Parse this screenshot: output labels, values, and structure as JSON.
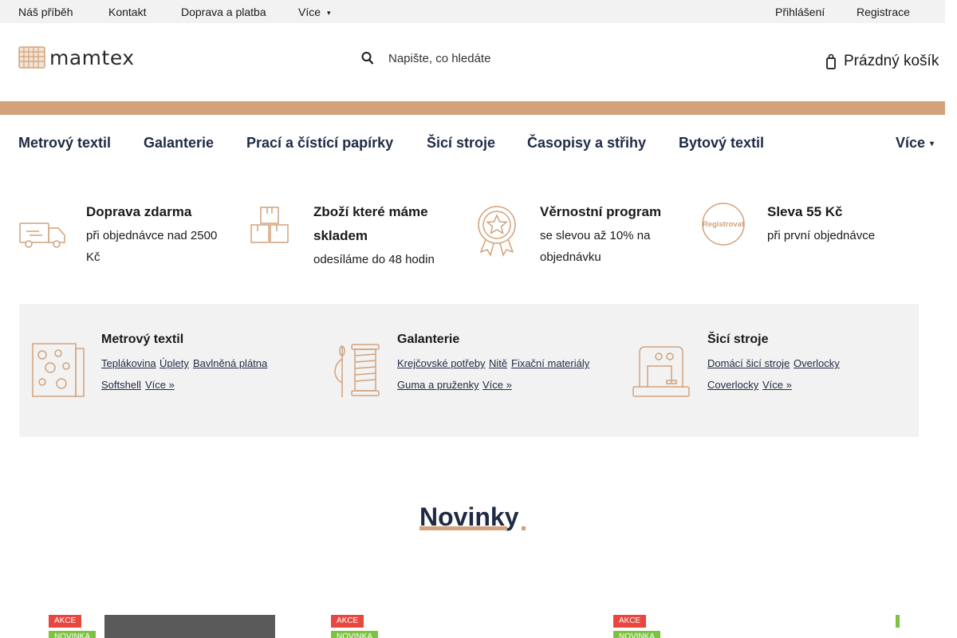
{
  "topbar": {
    "links": [
      "Náš příběh",
      "Kontakt",
      "Doprava a platba",
      "Více"
    ],
    "login": "Přihlášení",
    "register": "Registrace"
  },
  "header": {
    "logo_text": "mamtex",
    "search_placeholder": "Napište, co hledáte",
    "cart_label": "Prázdný košík"
  },
  "nav": {
    "items": [
      "Metrový textil",
      "Galanterie",
      "Prací a čístící papírky",
      "Šicí stroje",
      "Časopisy a střihy",
      "Bytový textil"
    ],
    "more": "Více"
  },
  "benefits": [
    {
      "icon": "delivery-truck-icon",
      "title": "Doprava zdarma",
      "sub_line1": "při objednávce nad 2500",
      "sub_line2": "Kč"
    },
    {
      "icon": "boxes-icon",
      "title_line1": "Zboží které máme",
      "title_line2": "skladem",
      "sub_line1": "odesíláme do 48 hodin"
    },
    {
      "icon": "award-icon",
      "title": "Věrnostní program",
      "sub_line1": "se slevou až 10% na",
      "sub_line2": "objednávku"
    },
    {
      "icon": "registrovat-stamp-icon",
      "stamp_text": "Registrovat",
      "title": "Sleva 55 Kč",
      "sub_line1": "při první objednávce"
    }
  ],
  "categories": [
    {
      "icon": "fabric-icon",
      "title": "Metrový textil",
      "links": [
        "Teplákovina",
        "Úplety",
        "Bavlněná plátna",
        "Softshell",
        "Více »"
      ]
    },
    {
      "icon": "thread-needle-icon",
      "title": "Galanterie",
      "links": [
        "Krejčovské potřeby",
        "Nitě",
        "Fixační materiály",
        "Guma a pruženky",
        "Více »"
      ]
    },
    {
      "icon": "sewing-machine-icon",
      "title": "Šicí stroje",
      "links": [
        "Domácí šicí stroje",
        "Overlocky",
        "Coverlocky",
        "Více »"
      ]
    }
  ],
  "novinky": {
    "title": "Novinky"
  },
  "products": [
    {
      "badges": [
        "AKCE",
        "NOVINKA"
      ]
    },
    {
      "badges": [
        "AKCE",
        "NOVINKA"
      ]
    },
    {
      "badges": [
        "AKCE",
        "NOVINKA"
      ]
    }
  ],
  "colors": {
    "accent": "#d2a27c",
    "nav_text": "#1f2a44",
    "badge_akce": "#e8473f",
    "badge_novinka": "#7dc243"
  }
}
